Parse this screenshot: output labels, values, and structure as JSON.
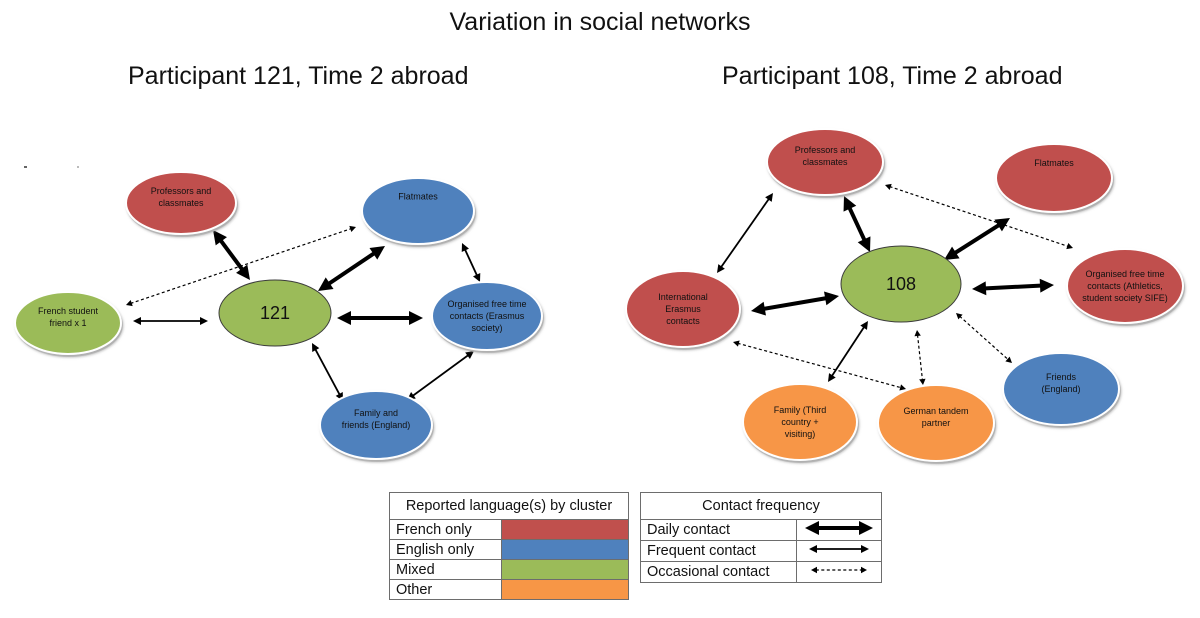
{
  "title": "Variation in social networks",
  "colors": {
    "french_only": "#c0504d",
    "english_only": "#4f81bd",
    "mixed": "#9bbb59",
    "other": "#f79646",
    "ego": "#9bbb59",
    "edge": "#000000"
  },
  "networks": [
    {
      "subtitle": "Participant 121, Time 2 abroad",
      "ego": {
        "id": "121",
        "label": "121"
      },
      "nodes": [
        {
          "id": "prof",
          "lines": [
            "Professors and",
            "classmates"
          ],
          "language": "french_only"
        },
        {
          "id": "flat",
          "lines": [
            "Flatmates"
          ],
          "language": "english_only"
        },
        {
          "id": "french",
          "lines": [
            "French student",
            "friend x 1"
          ],
          "language": "mixed"
        },
        {
          "id": "org",
          "lines": [
            "Organised free time",
            "contacts (Erasmus",
            "society)"
          ],
          "language": "english_only"
        },
        {
          "id": "family",
          "lines": [
            "Family and",
            "friends (England)"
          ],
          "language": "english_only"
        }
      ],
      "edges": [
        {
          "from": "121",
          "to": "prof",
          "frequency": "daily"
        },
        {
          "from": "121",
          "to": "flat",
          "frequency": "daily"
        },
        {
          "from": "121",
          "to": "org",
          "frequency": "daily"
        },
        {
          "from": "121",
          "to": "french",
          "frequency": "frequent"
        },
        {
          "from": "121",
          "to": "family",
          "frequency": "frequent"
        },
        {
          "from": "flat",
          "to": "org",
          "frequency": "frequent"
        },
        {
          "from": "org",
          "to": "family",
          "frequency": "frequent"
        },
        {
          "from": "french",
          "to": "flat",
          "frequency": "occasional"
        }
      ]
    },
    {
      "subtitle": "Participant 108, Time 2 abroad",
      "ego": {
        "id": "108",
        "label": "108"
      },
      "nodes": [
        {
          "id": "prof",
          "lines": [
            "Professors and",
            "classmates"
          ],
          "language": "french_only"
        },
        {
          "id": "flat",
          "lines": [
            "Flatmates"
          ],
          "language": "french_only"
        },
        {
          "id": "intl",
          "lines": [
            "International",
            "Erasmus",
            "contacts"
          ],
          "language": "french_only"
        },
        {
          "id": "org",
          "lines": [
            "Organised free time",
            "contacts (Athletics,",
            "student society SIFE)"
          ],
          "language": "french_only"
        },
        {
          "id": "friends",
          "lines": [
            "Friends",
            "(England)"
          ],
          "language": "english_only"
        },
        {
          "id": "family",
          "lines": [
            "Family (Third",
            "country +",
            "visiting)"
          ],
          "language": "other"
        },
        {
          "id": "tandem",
          "lines": [
            "German tandem",
            "partner"
          ],
          "language": "other"
        }
      ],
      "edges": [
        {
          "from": "108",
          "to": "prof",
          "frequency": "daily"
        },
        {
          "from": "108",
          "to": "flat",
          "frequency": "daily"
        },
        {
          "from": "108",
          "to": "intl",
          "frequency": "daily"
        },
        {
          "from": "108",
          "to": "org",
          "frequency": "daily"
        },
        {
          "from": "108",
          "to": "family",
          "frequency": "frequent"
        },
        {
          "from": "prof",
          "to": "intl",
          "frequency": "frequent"
        },
        {
          "from": "108",
          "to": "tandem",
          "frequency": "occasional"
        },
        {
          "from": "108",
          "to": "friends",
          "frequency": "occasional"
        },
        {
          "from": "prof",
          "to": "org",
          "frequency": "occasional"
        },
        {
          "from": "intl",
          "to": "tandem",
          "frequency": "occasional"
        }
      ]
    }
  ],
  "legend_language": {
    "header": "Reported language(s) by cluster",
    "rows": [
      {
        "label": "French only",
        "key": "french_only"
      },
      {
        "label": "English only",
        "key": "english_only"
      },
      {
        "label": "Mixed",
        "key": "mixed"
      },
      {
        "label": "Other",
        "key": "other"
      }
    ]
  },
  "legend_frequency": {
    "header": "Contact frequency",
    "rows": [
      {
        "label": "Daily contact",
        "key": "daily"
      },
      {
        "label": "Frequent contact",
        "key": "frequent"
      },
      {
        "label": "Occasional contact",
        "key": "occasional"
      }
    ]
  }
}
